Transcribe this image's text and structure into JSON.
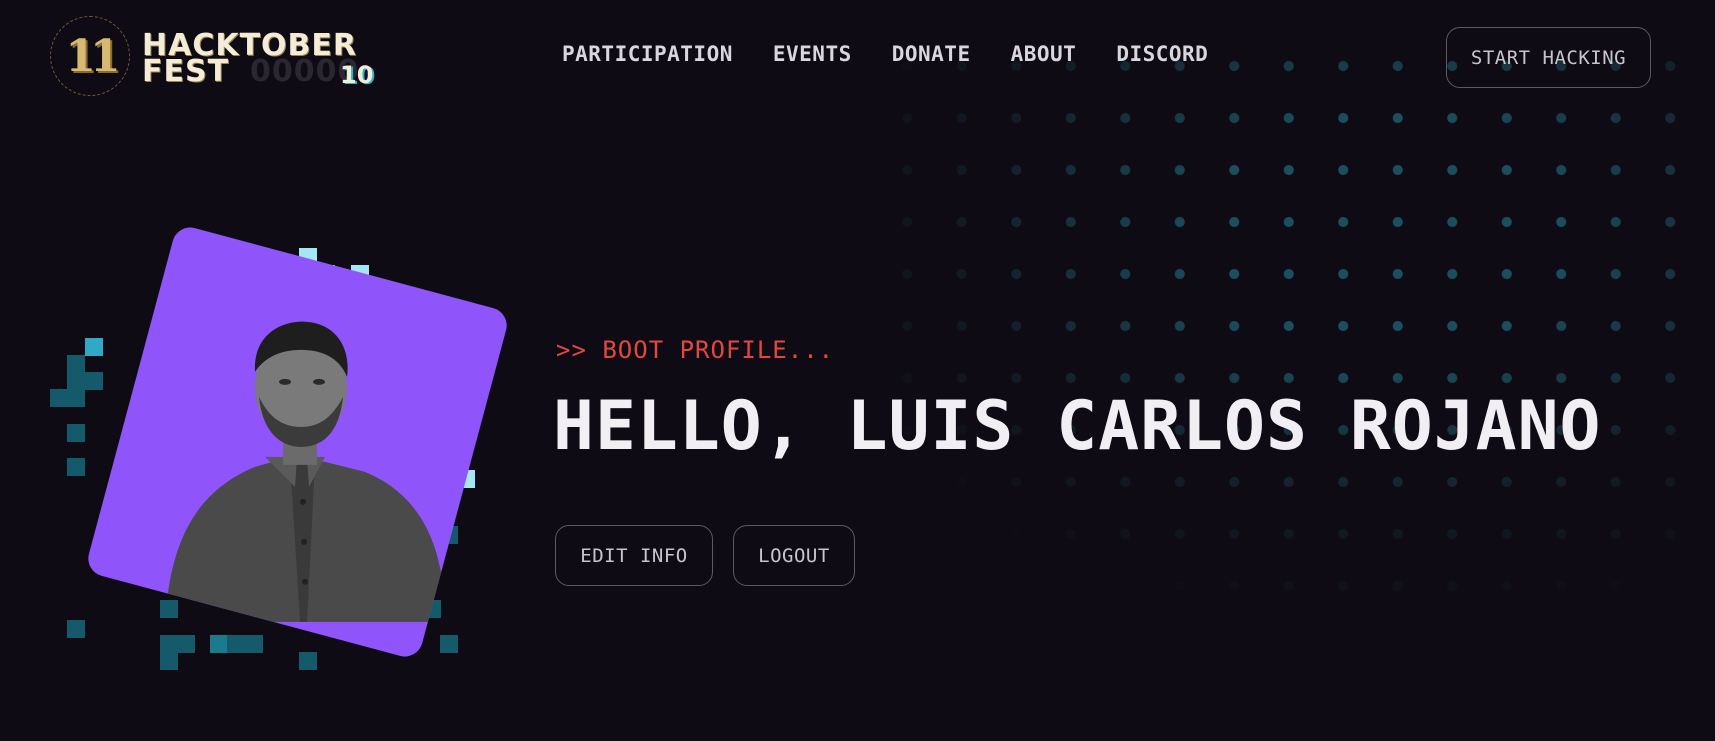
{
  "header": {
    "logo": {
      "badge_glyph": "11",
      "word_line1": "HACKTOBER",
      "word_line2": "FEST",
      "ghost_text": "00000",
      "edition": "10"
    },
    "nav": [
      {
        "label": "PARTICIPATION"
      },
      {
        "label": "EVENTS"
      },
      {
        "label": "DONATE"
      },
      {
        "label": "ABOUT"
      },
      {
        "label": "DISCORD"
      }
    ],
    "cta_label": "START HACKING"
  },
  "profile": {
    "boot_text": ">> BOOT PROFILE...",
    "greeting": "HELLO, LUIS CARLOS ROJANO",
    "edit_label": "EDIT INFO",
    "logout_label": "LOGOUT"
  },
  "colors": {
    "background": "#0f0b14",
    "accent_purple": "#8f55fb",
    "boot_red": "#e4473f",
    "pixel_teal": "#2bb3c6",
    "dot_teal": "#206474",
    "text_light": "#f1eff3"
  }
}
